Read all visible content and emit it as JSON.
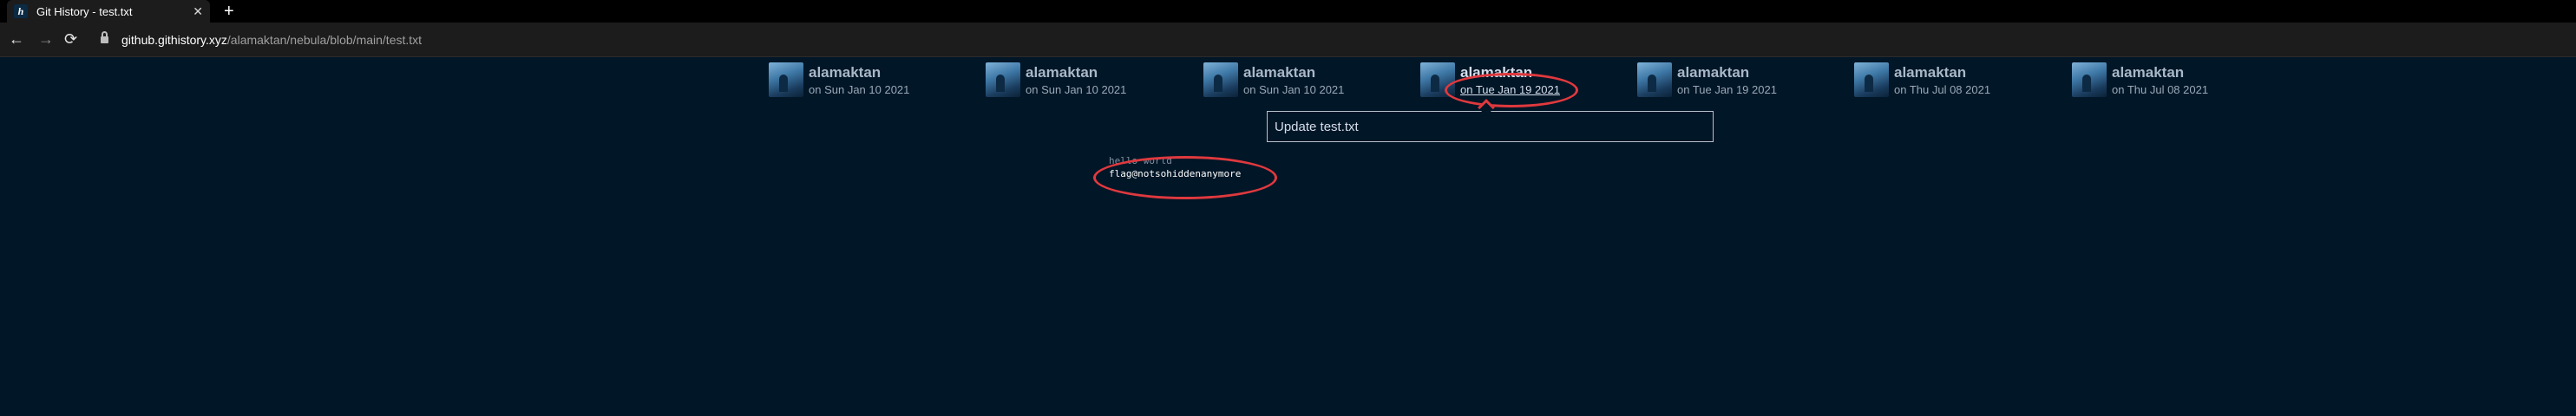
{
  "browser": {
    "tab_title": "Git History - test.txt",
    "tab_favicon": "h",
    "close_glyph": "✕",
    "new_tab_glyph": "+",
    "url_host": "github.githistory.xyz",
    "url_path": "/alamaktan/nebula/blob/main/test.txt",
    "back_glyph": "←",
    "forward_glyph": "→",
    "reload_glyph": "⟳"
  },
  "commits": [
    {
      "author": "alamaktan",
      "date": "on Sun Jan 10 2021"
    },
    {
      "author": "alamaktan",
      "date": "on Sun Jan 10 2021"
    },
    {
      "author": "alamaktan",
      "date": "on Sun Jan 10 2021"
    },
    {
      "author": "alamaktan",
      "date": "on Tue Jan 19 2021",
      "selected": true
    },
    {
      "author": "alamaktan",
      "date": "on Tue Jan 19 2021"
    },
    {
      "author": "alamaktan",
      "date": "on Thu Jul 08 2021"
    },
    {
      "author": "alamaktan",
      "date": "on Thu Jul 08 2021"
    }
  ],
  "commit_message": "Update test.txt",
  "file_content": {
    "old_line": "hello world",
    "new_line": "flag@notsohiddenanymore"
  },
  "colors": {
    "background": "#011627",
    "annotation": "#e0393e"
  }
}
